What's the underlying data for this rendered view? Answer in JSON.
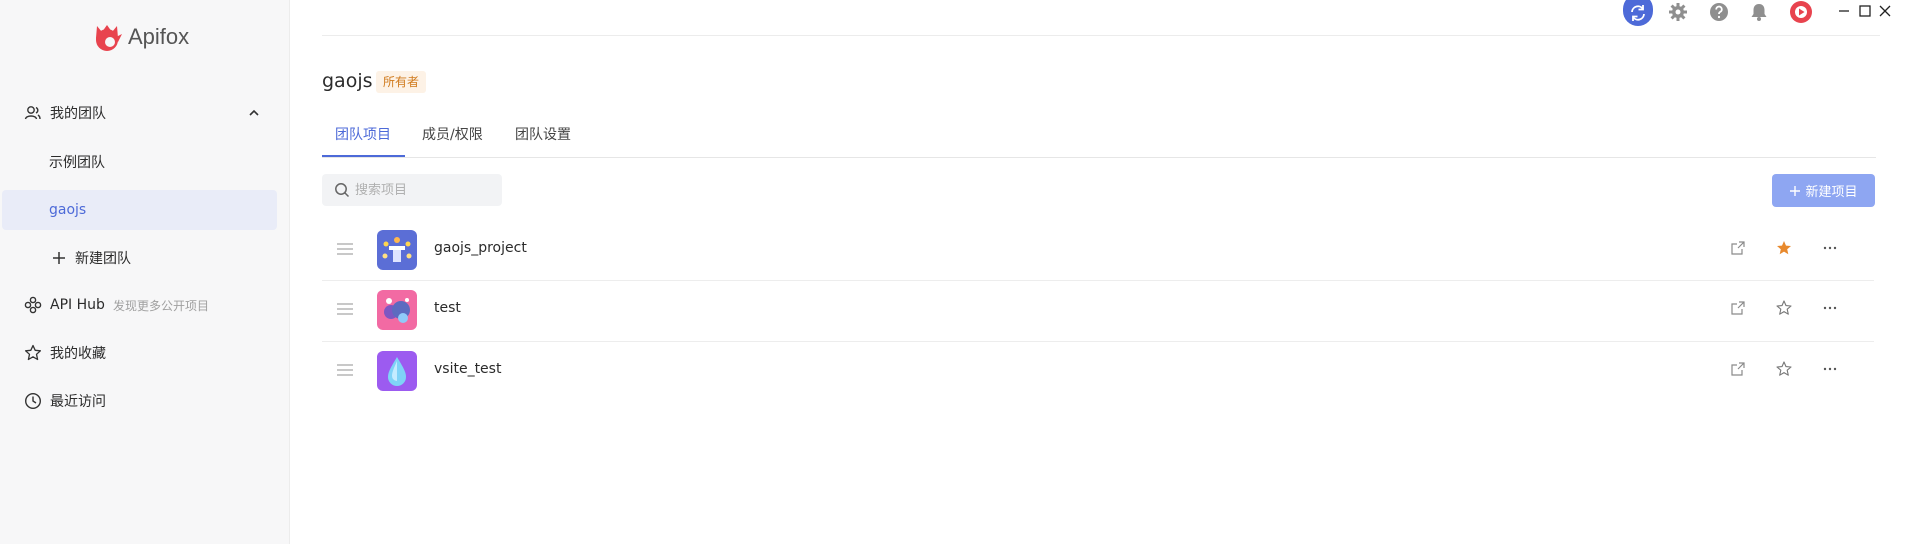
{
  "app": {
    "name": "Apifox"
  },
  "sidebar": {
    "my_team": "我的团队",
    "teams": [
      {
        "label": "示例团队"
      },
      {
        "label": "gaojs"
      }
    ],
    "new_team": "新建团队",
    "api_hub": {
      "label": "API Hub",
      "sub": "发现更多公开项目"
    },
    "favorites": "我的收藏",
    "recent": "最近访问"
  },
  "header": {
    "team_name": "gaojs",
    "role_badge": "所有者",
    "tabs": [
      {
        "label": "团队项目"
      },
      {
        "label": "成员/权限"
      },
      {
        "label": "团队设置"
      }
    ]
  },
  "toolbar": {
    "search_placeholder": "搜索项目",
    "new_project": "新建项目"
  },
  "projects": [
    {
      "name": "gaojs_project",
      "starred": true
    },
    {
      "name": "test",
      "starred": false
    },
    {
      "name": "vsite_test",
      "starred": false
    }
  ],
  "colors": {
    "accent": "#4d6ad8",
    "button": "#8ea6f2",
    "star_filled": "#e8892d",
    "sidebar_bg": "#f7f7f8"
  },
  "icons": {
    "top_bar": [
      "sync-icon",
      "settings-icon",
      "help-icon",
      "bell-icon",
      "avatar"
    ],
    "window": [
      "minimize-icon",
      "maximize-icon",
      "close-icon"
    ]
  }
}
